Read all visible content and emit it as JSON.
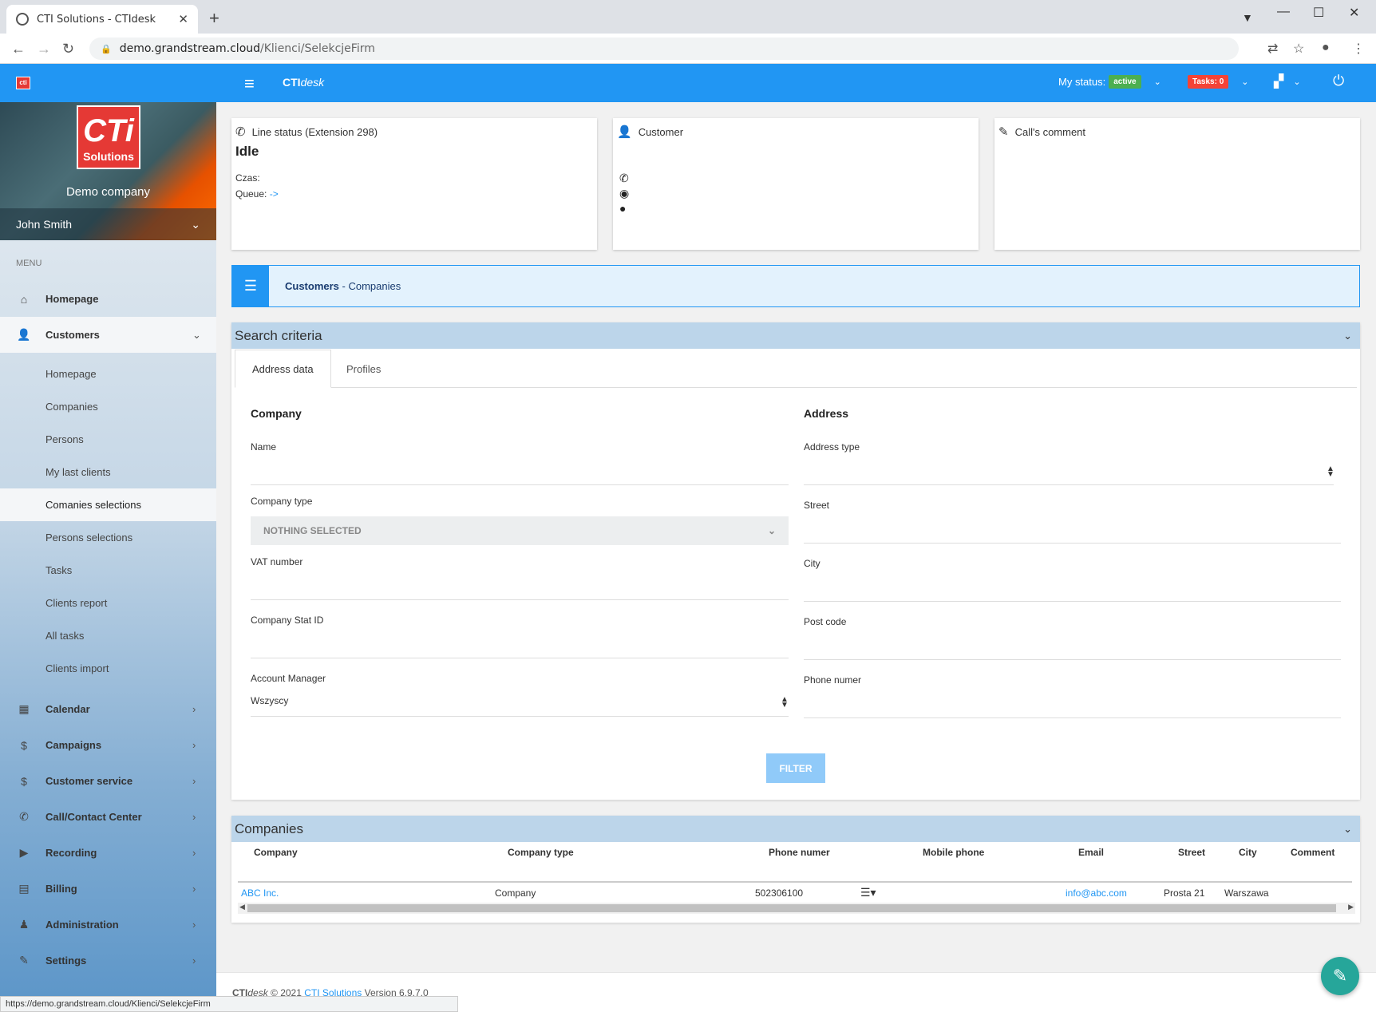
{
  "browser": {
    "tab_title": "CTI Solutions - CTIdesk",
    "url_host": "demo.grandstream.cloud",
    "url_path": "/Klienci/SelekcjeFirm",
    "status_url": "https://demo.grandstream.cloud/Klienci/SelekcjeFirm"
  },
  "header": {
    "logo_small": "cti",
    "brand_bold": "CTI",
    "brand_italic": "desk",
    "my_status_label": "My status:",
    "my_status_value": "active",
    "tasks_label": "Tasks: 0"
  },
  "sidebar": {
    "logo_big": "CTi",
    "logo_small": "Solutions",
    "company": "Demo company",
    "user": "John Smith",
    "menu_label": "MENU",
    "items": [
      {
        "label": "Homepage",
        "icon": "home-icon"
      },
      {
        "label": "Customers",
        "icon": "user-icon"
      },
      {
        "label": "Calendar",
        "icon": "calendar-icon"
      },
      {
        "label": "Campaigns",
        "icon": "dollar-icon"
      },
      {
        "label": "Customer service",
        "icon": "dollar-icon"
      },
      {
        "label": "Call/Contact Center",
        "icon": "phone-icon"
      },
      {
        "label": "Recording",
        "icon": "play-icon"
      },
      {
        "label": "Billing",
        "icon": "billing-icon"
      },
      {
        "label": "Administration",
        "icon": "admin-icon"
      },
      {
        "label": "Settings",
        "icon": "wrench-icon"
      }
    ],
    "subitems": [
      "Homepage",
      "Companies",
      "Persons",
      "My last clients",
      "Comanies selections",
      "Persons selections",
      "Tasks",
      "Clients report",
      "All tasks",
      "Clients import"
    ]
  },
  "cards": {
    "line_status": "Line status (Extension 298)",
    "state": "Idle",
    "czas": "Czas:",
    "queue": "Queue:",
    "queue_value": "->",
    "customer": "Customer",
    "comment": "Call's comment"
  },
  "breadcrumb": {
    "bold": "Customers",
    "rest": " - Companies"
  },
  "search": {
    "title": "Search criteria",
    "tabs": [
      "Address data",
      "Profiles"
    ],
    "company_title": "Company",
    "address_title": "Address",
    "name_label": "Name",
    "company_type_label": "Company type",
    "company_type_value": "NOTHING SELECTED",
    "vat_label": "VAT number",
    "stat_label": "Company Stat ID",
    "account_manager_label": "Account Manager",
    "account_manager_value": "Wszyscy",
    "address_type_label": "Address type",
    "street_label": "Street",
    "city_label": "City",
    "post_code_label": "Post code",
    "phone_label": "Phone numer",
    "filter_button": "FILTER"
  },
  "companies": {
    "title": "Companies",
    "columns": [
      "Company",
      "Company type",
      "Phone numer",
      "Mobile phone",
      "Email",
      "Street",
      "City",
      "Comment"
    ],
    "rows": [
      {
        "company": "ABC Inc.",
        "type": "Company",
        "phone": "502306100",
        "mobile": "",
        "email": "info@abc.com",
        "street": "Prosta 21",
        "city": "Warszawa",
        "comment": ""
      }
    ]
  },
  "footer": {
    "brand_bold": "CTI",
    "brand_italic": "desk",
    "copy": " © 2021 ",
    "company_link": "CTI Solutions",
    "version": " Version 6.9.7.0"
  },
  "colors": {
    "header_blue": "#2196f3",
    "active_green": "#4caf50",
    "tasks_red": "#f44336",
    "fab_teal": "#26a69a"
  }
}
